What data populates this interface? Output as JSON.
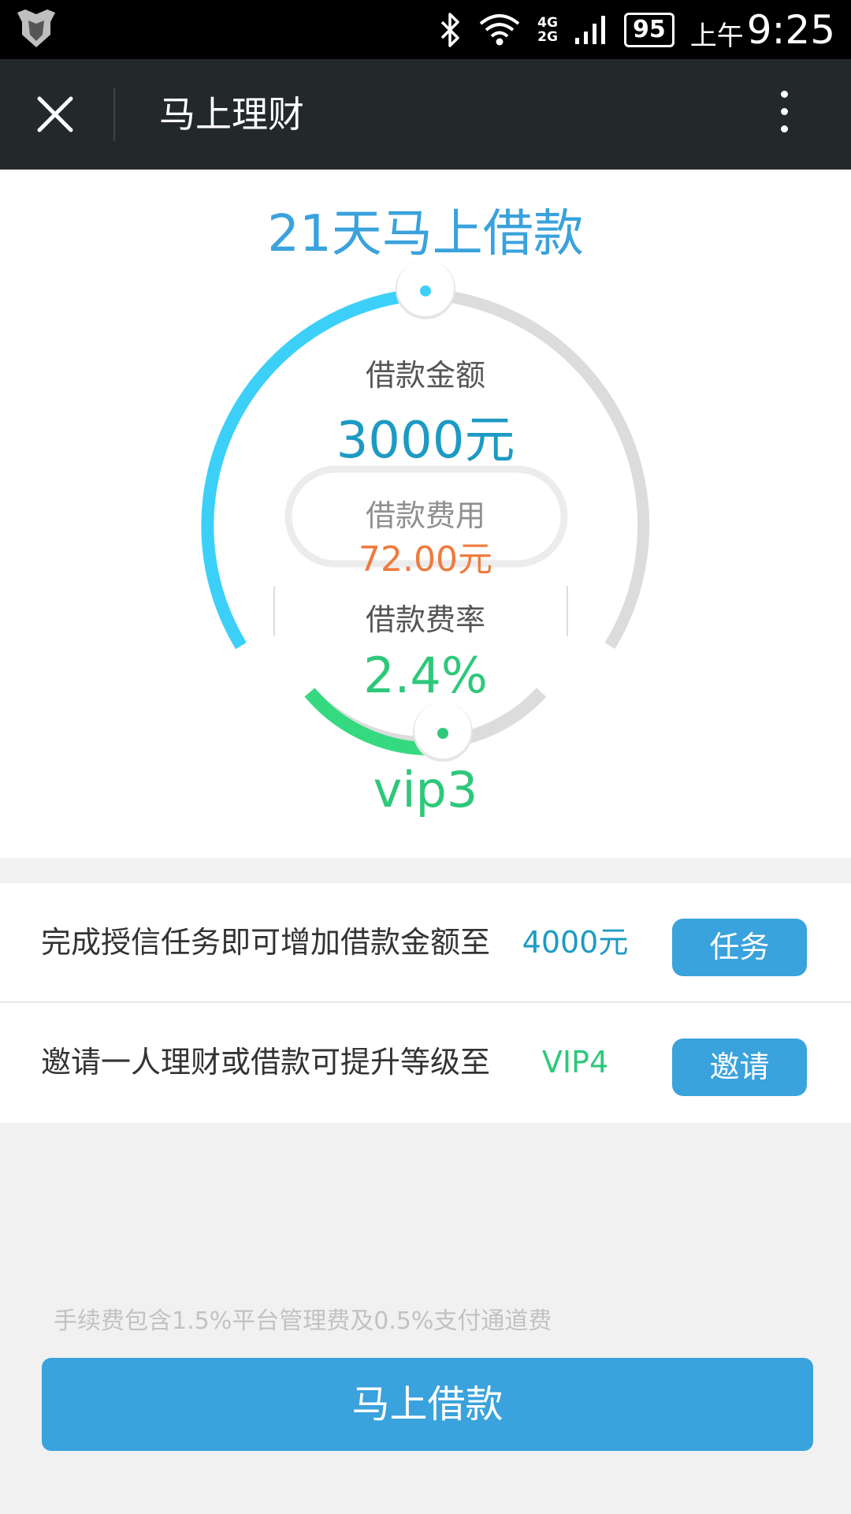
{
  "status_bar": {
    "network_top": "4G",
    "network_bottom": "2G",
    "battery": "95",
    "ampm": "上午",
    "time": "9:25",
    "icons": [
      "shield-icon",
      "bluetooth-icon",
      "wifi-icon",
      "signal-icon"
    ]
  },
  "app_bar": {
    "title": "马上理财",
    "icons": [
      "close-icon",
      "more-vertical-icon"
    ]
  },
  "loan": {
    "headline": "21天马上借款",
    "amount_label": "借款金额",
    "amount_value": "3000元",
    "fee_label": "借款费用",
    "fee_value": "72.00元",
    "rate_label": "借款费率",
    "rate_value": "2.4%",
    "vip_level": "vip3",
    "amount_slider_fraction": 0.5,
    "vip_slider_fraction": 0.55
  },
  "tasks": [
    {
      "description": "完成授信任务即可增加借款金额至",
      "value": "4000元",
      "value_color": "#1d9ac4",
      "button": "任务"
    },
    {
      "description": "邀请一人理财或借款可提升等级至",
      "value": "VIP4",
      "value_color": "#2ec87b",
      "button": "邀请"
    }
  ],
  "footnote": "手续费包含1.5%平台管理费及0.5%支付通道费",
  "primary_button": "马上借款",
  "colors": {
    "accent": "#3aa2dc",
    "green": "#2ec87b",
    "orange": "#ef7b3e",
    "arc_blue": "#3cd0f8",
    "track": "#dcdcdc"
  }
}
